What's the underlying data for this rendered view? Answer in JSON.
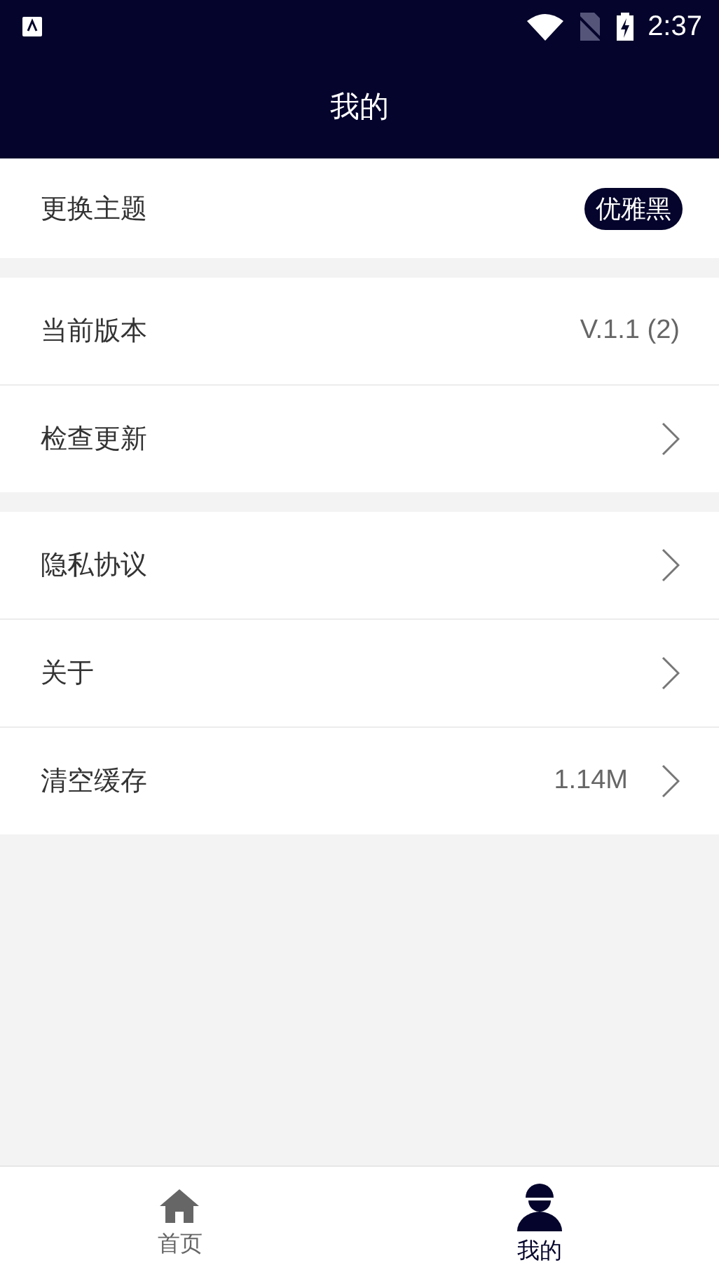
{
  "status_bar": {
    "time": "2:37"
  },
  "header": {
    "title": "我的"
  },
  "groups": [
    {
      "rows": [
        {
          "label": "更换主题",
          "badge": "优雅黑",
          "chevron": false
        }
      ]
    },
    {
      "rows": [
        {
          "label": "当前版本",
          "value": "V.1.1 (2)",
          "chevron": false
        },
        {
          "label": "检查更新",
          "chevron": true
        }
      ]
    },
    {
      "rows": [
        {
          "label": "隐私协议",
          "chevron": true
        },
        {
          "label": "关于",
          "chevron": true
        },
        {
          "label": "清空缓存",
          "value": "1.14M",
          "chevron": true
        }
      ]
    }
  ],
  "bottom_nav": [
    {
      "label": "首页",
      "kind": "home",
      "selected": false
    },
    {
      "label": "我的",
      "kind": "profile",
      "selected": true
    }
  ]
}
